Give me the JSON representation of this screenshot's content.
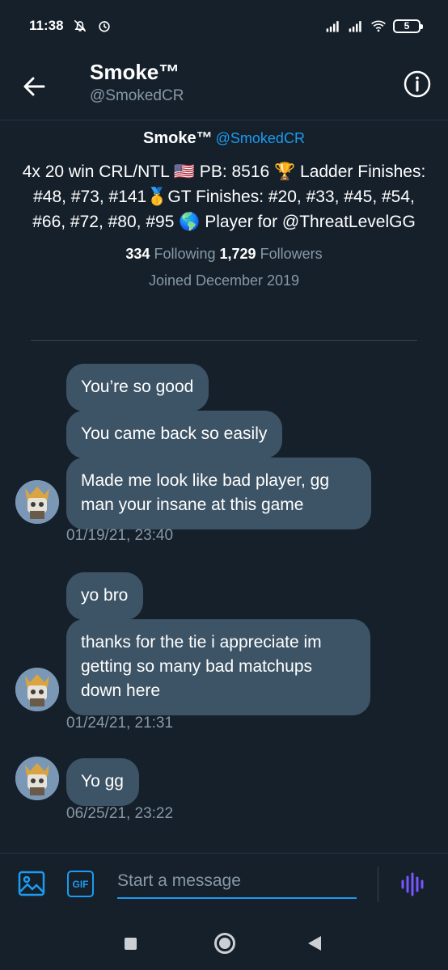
{
  "status_bar": {
    "time": "11:38",
    "battery": "5"
  },
  "header": {
    "name": "Smoke™",
    "handle": "@SmokedCR"
  },
  "profile": {
    "name": "Smoke™",
    "handle": "@SmokedCR",
    "bio": "4x 20 win CRL/NTL 🇺🇸 PB: 8516 🏆 Ladder Finishes: #48, #73, #141🥇GT Finishes: #20, #33, #45, #54, #66, #72, #80, #95 🌎 Player for @ThreatLevelGG",
    "following_count": "334",
    "following_label": "Following",
    "followers_count": "1,729",
    "followers_label": "Followers",
    "joined": "Joined December 2019"
  },
  "messages": [
    {
      "bubbles": [
        "You’re so good",
        "You came back so easily",
        "Made me look like bad player, gg man your insane at this game"
      ],
      "timestamp": "01/19/21, 23:40"
    },
    {
      "bubbles": [
        "yo bro",
        "thanks for the tie i appreciate im getting so many bad matchups down here"
      ],
      "timestamp": "01/24/21, 21:31"
    },
    {
      "bubbles": [
        "Yo gg"
      ],
      "timestamp": "06/25/21, 23:22"
    }
  ],
  "compose": {
    "gif_label": "GIF",
    "placeholder": "Start a message"
  },
  "colors": {
    "background": "#15202b",
    "bubble": "#3d5466",
    "accent": "#1d9bf0",
    "secondary_text": "#8899a6",
    "voice_accent": "#7856ff"
  },
  "icons": {
    "back": "arrow-left-icon",
    "info": "info-icon",
    "image": "image-icon",
    "voice": "voice-wave-icon"
  }
}
